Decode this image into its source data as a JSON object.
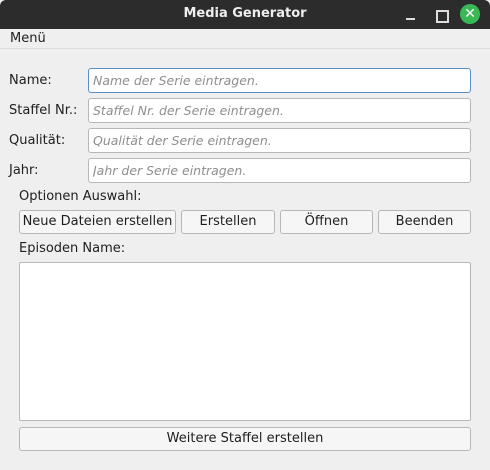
{
  "window": {
    "title": "Media Generator"
  },
  "menubar": {
    "menu_label": "Menü"
  },
  "form": {
    "name": {
      "label": "Name:",
      "value": "",
      "placeholder": "Name der Serie eintragen."
    },
    "staffel": {
      "label": "Staffel Nr.:",
      "value": "",
      "placeholder": "Staffel Nr. der Serie eintragen."
    },
    "qualitaet": {
      "label": "Qualität:",
      "value": "",
      "placeholder": "Qualität der Serie eintragen."
    },
    "jahr": {
      "label": "Jahr:",
      "value": "",
      "placeholder": "Jahr der Serie eintragen."
    }
  },
  "options": {
    "label": "Optionen Auswahl:",
    "buttons": {
      "neue_dateien": "Neue Dateien erstellen",
      "erstellen": "Erstellen",
      "oeffnen": "Öffnen",
      "beenden": "Beenden"
    }
  },
  "episoden": {
    "label": "Episoden Name:",
    "value": ""
  },
  "footer": {
    "weitere_staffel": "Weitere Staffel erstellen"
  },
  "colors": {
    "titlebar": "#2c2c2c",
    "close_button": "#3bb856",
    "focus_border": "#5b8ec5",
    "window_bg": "#efefef"
  },
  "icons": {
    "minimize": "minimize-icon",
    "maximize": "maximize-icon",
    "close": "close-icon"
  }
}
